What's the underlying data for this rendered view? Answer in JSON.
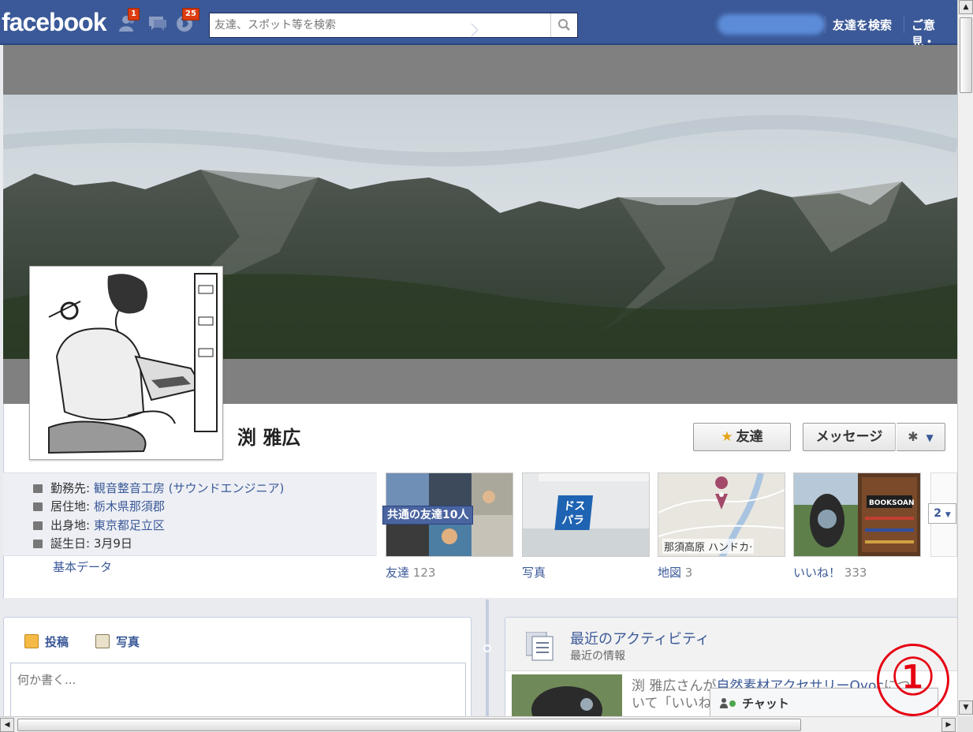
{
  "topbar": {
    "logo": "facebook",
    "friend_requests_count": "1",
    "notifications_count": "25",
    "search_placeholder": "友達、スポット等を検索",
    "find_friends": "友達を検索",
    "feedback": "ご意見・"
  },
  "profile": {
    "name": "渕 雅広",
    "friend_button": "友達",
    "message_button": "メッセージ",
    "info": {
      "work_label": "勤務先: ",
      "work_value": "観音整音工房 (サウンドエンジニア)",
      "lives_label": "居住地: ",
      "lives_value": "栃木県那須郡",
      "from_label": "出身地: ",
      "from_value": "東京都足立区",
      "birthday": "誕生日: 3月9日",
      "basic_data": "基本データ"
    }
  },
  "tiles": {
    "mutual_friends": "共通の友達10人",
    "friends_label": "友達",
    "friends_count": "123",
    "photos_label": "写真",
    "map_label": "地図",
    "map_count": "3",
    "map_caption": "那須高原 ハンドカ·",
    "likes_label": "いいね！",
    "likes_count": "333",
    "more": "2"
  },
  "composer": {
    "post_tab": "投稿",
    "photo_tab": "写真",
    "placeholder": "何か書く..."
  },
  "activity": {
    "title": "最近のアクティビティ",
    "subtitle": "最近の情報",
    "text_prefix": "渕 雅広さんが",
    "text_link": "自然素材アクセサリーOyoc",
    "text_suffix": "につ",
    "text_line2": "いて「いいね"
  },
  "chat": {
    "label": "チャット"
  },
  "annotation": {
    "label": "①"
  },
  "colors": {
    "brand": "#3b5998",
    "badge": "#dd3c10",
    "annotation": "#e60012"
  }
}
